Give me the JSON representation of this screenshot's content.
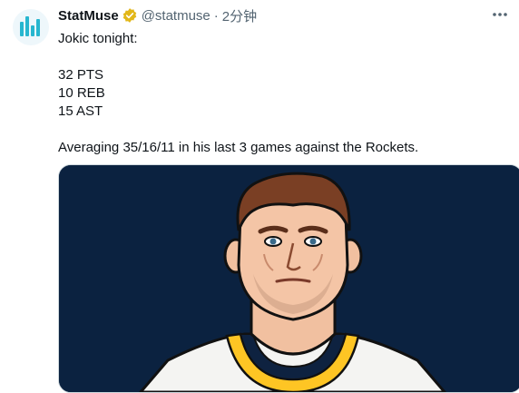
{
  "tweet": {
    "author_name": "StatMuse",
    "author_handle": "@statmuse",
    "separator": "·",
    "timestamp": "2分钟",
    "verified_badge_icon": "gold-verified-badge-icon",
    "more_icon": "more-horizontal-icon",
    "text_lines": [
      "Jokic tonight:",
      "",
      "32 PTS",
      "10 REB",
      "15 AST",
      "",
      "Averaging 35/16/11 in his last 3 games against the Rockets."
    ],
    "media": {
      "kind": "illustration",
      "background_color": "#0b2240"
    }
  },
  "colors": {
    "text_primary": "#0f1419",
    "text_secondary": "#536471",
    "badge_gold": "#e2b719",
    "avatar_teal": "#27b6cf"
  }
}
